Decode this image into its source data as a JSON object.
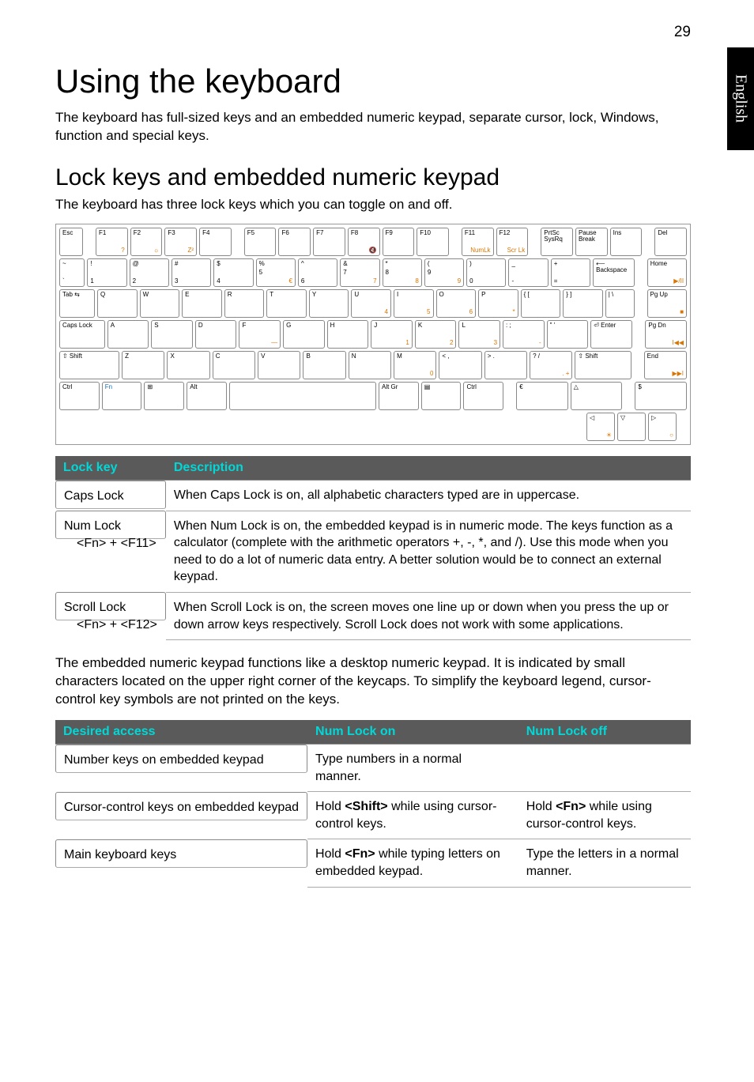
{
  "page_number": "29",
  "sidetab": "English",
  "h1": "Using the keyboard",
  "intro": "The keyboard has full-sized keys and an embedded numeric keypad, separate cursor, lock, Windows, function and special keys.",
  "h2": "Lock keys and embedded numeric keypad",
  "sub_intro": "The keyboard has three lock keys which you can toggle on and off.",
  "table1": {
    "headers": [
      "Lock key",
      "Description"
    ],
    "rows": [
      {
        "key": "Caps Lock",
        "sub": "",
        "desc": "When Caps Lock is on, all alphabetic characters typed are in uppercase."
      },
      {
        "key": "Num Lock",
        "sub": "<Fn> + <F11>",
        "desc": "When Num Lock is on, the embedded keypad is in numeric mode. The keys function as a calculator (complete with the arithmetic operators +, -, *, and /). Use this mode when you need to do a lot of numeric data entry. A better solution would be to connect an external keypad."
      },
      {
        "key": "Scroll Lock",
        "sub": "<Fn> + <F12>",
        "desc": "When Scroll Lock is on, the screen moves one line up or down when you press the up or down arrow keys respectively. Scroll Lock does not work with some applications."
      }
    ]
  },
  "mid_para": "The embedded numeric keypad functions like a desktop numeric keypad. It is indicated by small characters located on the upper right corner of the keycaps. To simplify the keyboard legend, cursor-control key symbols are not printed on the keys.",
  "table2": {
    "headers": [
      "Desired access",
      "Num Lock on",
      "Num Lock off"
    ],
    "rows": [
      {
        "c1": "Number keys on embedded keypad",
        "c2": "Type numbers in a normal manner.",
        "c3": ""
      },
      {
        "c1": "Cursor-control keys on embedded keypad",
        "c2": "Hold <Shift> while using cursor-control keys.",
        "c3": "Hold <Fn> while using cursor-control keys."
      },
      {
        "c1": "Main keyboard keys",
        "c2": "Hold <Fn> while typing letters on embedded keypad.",
        "c3": "Type the letters in a normal manner."
      }
    ]
  },
  "kbd": {
    "r1": [
      "Esc",
      "F1",
      "F2",
      "F3",
      "F4",
      "F5",
      "F6",
      "F7",
      "F8",
      "F9",
      "F10",
      "F11",
      "F12",
      "PrtSc SysRq",
      "Pause Break",
      "Ins",
      "Del"
    ],
    "r1_sub": [
      "",
      "?",
      "☼",
      "Z²",
      "",
      "",
      "",
      "",
      "🔇",
      "",
      "",
      "NumLk",
      "Scr Lk",
      "",
      "",
      "",
      ""
    ],
    "r2": [
      [
        "~",
        "`"
      ],
      [
        "!",
        "1"
      ],
      [
        "@",
        "2"
      ],
      [
        "#",
        "3"
      ],
      [
        "$",
        "4"
      ],
      [
        "%",
        "5"
      ],
      [
        "^",
        "6"
      ],
      [
        "&",
        "7"
      ],
      [
        "*",
        "8"
      ],
      [
        "(",
        "9"
      ],
      [
        ")",
        "0"
      ],
      [
        "_",
        "-"
      ],
      [
        "+",
        "="
      ],
      [
        "⟵ Backspace",
        ""
      ],
      [
        "Home",
        ""
      ]
    ],
    "r2_sub": [
      "",
      "",
      "",
      "",
      "",
      "€",
      "",
      "7",
      "8",
      "9",
      "",
      "",
      "",
      "",
      "▶/II"
    ],
    "r3": [
      "Tab ⇆",
      "Q",
      "W",
      "E",
      "R",
      "T",
      "Y",
      "U",
      "I",
      "O",
      "P",
      "{ [",
      "} ]",
      "| \\",
      "Pg Up"
    ],
    "r3_sub": [
      "",
      "",
      "",
      "",
      "",
      "",
      "",
      "4",
      "5",
      "6",
      "*",
      "",
      "",
      "",
      "■"
    ],
    "r4": [
      "Caps Lock",
      "A",
      "S",
      "D",
      "F",
      "G",
      "H",
      "J",
      "K",
      "L",
      ": ;",
      "\" '",
      "⏎ Enter",
      "Pg Dn"
    ],
    "r4_sub": [
      "",
      "",
      "",
      "",
      "—",
      "",
      "",
      "1",
      "2",
      "3",
      "-",
      "",
      "",
      "I◀◀"
    ],
    "r5": [
      "⇧ Shift",
      "Z",
      "X",
      "C",
      "V",
      "B",
      "N",
      "M",
      "< ,",
      "> .",
      "? /",
      "⇧ Shift",
      "End"
    ],
    "r5_sub": [
      "",
      "",
      "",
      "",
      "",
      "",
      "",
      "0",
      "",
      "",
      ". +",
      "",
      "▶▶I"
    ],
    "r6": [
      "Ctrl",
      "Fn",
      "⊞",
      "Alt",
      "",
      "Alt Gr",
      "▤",
      "Ctrl",
      "€",
      "△",
      "$"
    ],
    "r7": [
      "◁",
      "▽",
      "▷"
    ],
    "r7_sub": [
      "☀",
      "",
      "○"
    ]
  }
}
